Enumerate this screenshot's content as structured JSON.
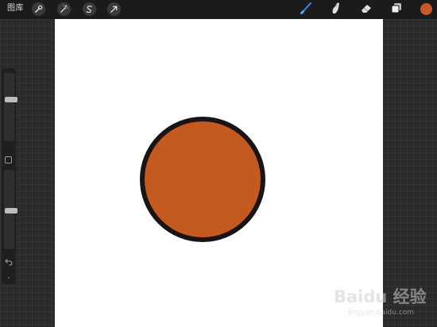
{
  "topbar": {
    "gallery_label": "图库",
    "left_tools": [
      "wrench-icon",
      "magic-wand-icon",
      "selection-icon",
      "transform-arrow-icon"
    ],
    "right_tools": [
      "brush-icon",
      "smudge-icon",
      "eraser-icon",
      "layers-icon"
    ],
    "active_tool": "brush-icon",
    "active_tool_color": "#2f7de1"
  },
  "color": {
    "current": "#c9572a"
  },
  "canvas": {
    "background": "#ffffff",
    "shape": {
      "type": "circle",
      "fill": "#c55a20",
      "stroke": "#1a1414"
    }
  },
  "sidebar": {
    "brush_size_level": 0.62,
    "opacity_level": 0.48,
    "modify_icon": "square-icon",
    "undo_icon": "undo-arrow-icon",
    "redo_icon": "redo-dot-icon"
  },
  "watermark": {
    "main": "Baidu 经验",
    "sub": "jingyan.baidu.com"
  }
}
